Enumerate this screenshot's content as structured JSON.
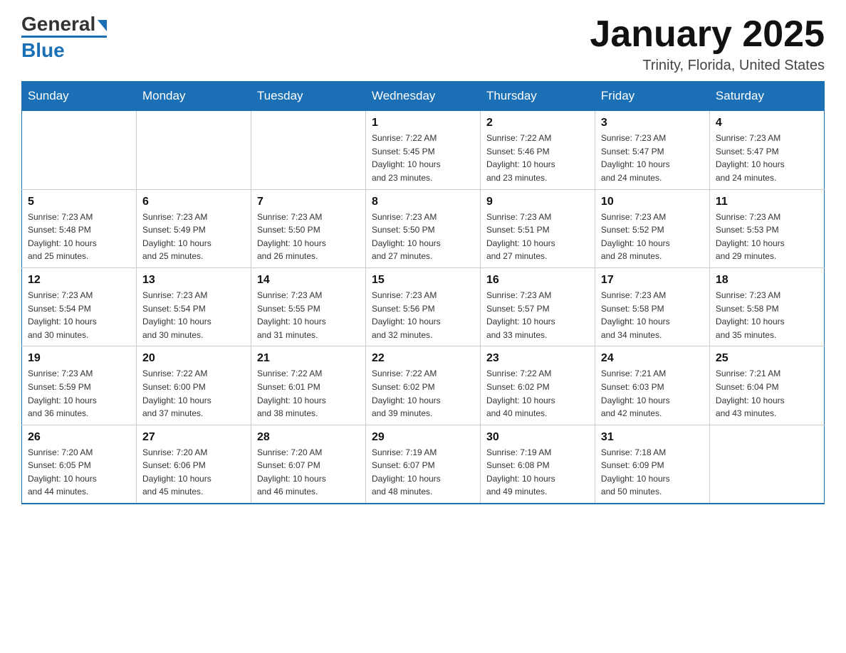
{
  "header": {
    "logo_main": "General",
    "logo_accent": "Blue",
    "month_title": "January 2025",
    "location": "Trinity, Florida, United States"
  },
  "days_of_week": [
    "Sunday",
    "Monday",
    "Tuesday",
    "Wednesday",
    "Thursday",
    "Friday",
    "Saturday"
  ],
  "weeks": [
    [
      {
        "day": "",
        "info": ""
      },
      {
        "day": "",
        "info": ""
      },
      {
        "day": "",
        "info": ""
      },
      {
        "day": "1",
        "info": "Sunrise: 7:22 AM\nSunset: 5:45 PM\nDaylight: 10 hours\nand 23 minutes."
      },
      {
        "day": "2",
        "info": "Sunrise: 7:22 AM\nSunset: 5:46 PM\nDaylight: 10 hours\nand 23 minutes."
      },
      {
        "day": "3",
        "info": "Sunrise: 7:23 AM\nSunset: 5:47 PM\nDaylight: 10 hours\nand 24 minutes."
      },
      {
        "day": "4",
        "info": "Sunrise: 7:23 AM\nSunset: 5:47 PM\nDaylight: 10 hours\nand 24 minutes."
      }
    ],
    [
      {
        "day": "5",
        "info": "Sunrise: 7:23 AM\nSunset: 5:48 PM\nDaylight: 10 hours\nand 25 minutes."
      },
      {
        "day": "6",
        "info": "Sunrise: 7:23 AM\nSunset: 5:49 PM\nDaylight: 10 hours\nand 25 minutes."
      },
      {
        "day": "7",
        "info": "Sunrise: 7:23 AM\nSunset: 5:50 PM\nDaylight: 10 hours\nand 26 minutes."
      },
      {
        "day": "8",
        "info": "Sunrise: 7:23 AM\nSunset: 5:50 PM\nDaylight: 10 hours\nand 27 minutes."
      },
      {
        "day": "9",
        "info": "Sunrise: 7:23 AM\nSunset: 5:51 PM\nDaylight: 10 hours\nand 27 minutes."
      },
      {
        "day": "10",
        "info": "Sunrise: 7:23 AM\nSunset: 5:52 PM\nDaylight: 10 hours\nand 28 minutes."
      },
      {
        "day": "11",
        "info": "Sunrise: 7:23 AM\nSunset: 5:53 PM\nDaylight: 10 hours\nand 29 minutes."
      }
    ],
    [
      {
        "day": "12",
        "info": "Sunrise: 7:23 AM\nSunset: 5:54 PM\nDaylight: 10 hours\nand 30 minutes."
      },
      {
        "day": "13",
        "info": "Sunrise: 7:23 AM\nSunset: 5:54 PM\nDaylight: 10 hours\nand 30 minutes."
      },
      {
        "day": "14",
        "info": "Sunrise: 7:23 AM\nSunset: 5:55 PM\nDaylight: 10 hours\nand 31 minutes."
      },
      {
        "day": "15",
        "info": "Sunrise: 7:23 AM\nSunset: 5:56 PM\nDaylight: 10 hours\nand 32 minutes."
      },
      {
        "day": "16",
        "info": "Sunrise: 7:23 AM\nSunset: 5:57 PM\nDaylight: 10 hours\nand 33 minutes."
      },
      {
        "day": "17",
        "info": "Sunrise: 7:23 AM\nSunset: 5:58 PM\nDaylight: 10 hours\nand 34 minutes."
      },
      {
        "day": "18",
        "info": "Sunrise: 7:23 AM\nSunset: 5:58 PM\nDaylight: 10 hours\nand 35 minutes."
      }
    ],
    [
      {
        "day": "19",
        "info": "Sunrise: 7:23 AM\nSunset: 5:59 PM\nDaylight: 10 hours\nand 36 minutes."
      },
      {
        "day": "20",
        "info": "Sunrise: 7:22 AM\nSunset: 6:00 PM\nDaylight: 10 hours\nand 37 minutes."
      },
      {
        "day": "21",
        "info": "Sunrise: 7:22 AM\nSunset: 6:01 PM\nDaylight: 10 hours\nand 38 minutes."
      },
      {
        "day": "22",
        "info": "Sunrise: 7:22 AM\nSunset: 6:02 PM\nDaylight: 10 hours\nand 39 minutes."
      },
      {
        "day": "23",
        "info": "Sunrise: 7:22 AM\nSunset: 6:02 PM\nDaylight: 10 hours\nand 40 minutes."
      },
      {
        "day": "24",
        "info": "Sunrise: 7:21 AM\nSunset: 6:03 PM\nDaylight: 10 hours\nand 42 minutes."
      },
      {
        "day": "25",
        "info": "Sunrise: 7:21 AM\nSunset: 6:04 PM\nDaylight: 10 hours\nand 43 minutes."
      }
    ],
    [
      {
        "day": "26",
        "info": "Sunrise: 7:20 AM\nSunset: 6:05 PM\nDaylight: 10 hours\nand 44 minutes."
      },
      {
        "day": "27",
        "info": "Sunrise: 7:20 AM\nSunset: 6:06 PM\nDaylight: 10 hours\nand 45 minutes."
      },
      {
        "day": "28",
        "info": "Sunrise: 7:20 AM\nSunset: 6:07 PM\nDaylight: 10 hours\nand 46 minutes."
      },
      {
        "day": "29",
        "info": "Sunrise: 7:19 AM\nSunset: 6:07 PM\nDaylight: 10 hours\nand 48 minutes."
      },
      {
        "day": "30",
        "info": "Sunrise: 7:19 AM\nSunset: 6:08 PM\nDaylight: 10 hours\nand 49 minutes."
      },
      {
        "day": "31",
        "info": "Sunrise: 7:18 AM\nSunset: 6:09 PM\nDaylight: 10 hours\nand 50 minutes."
      },
      {
        "day": "",
        "info": ""
      }
    ]
  ]
}
